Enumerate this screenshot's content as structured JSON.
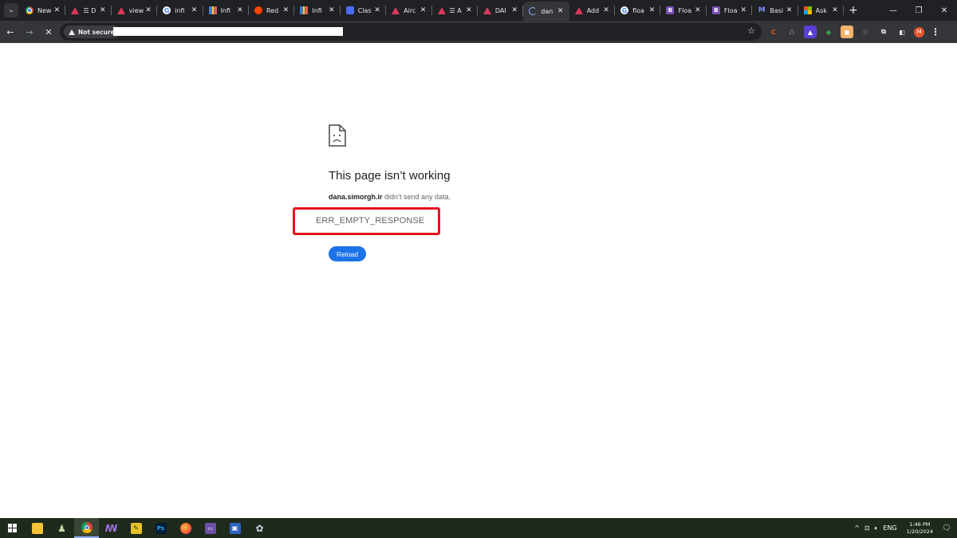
{
  "tabs": [
    {
      "label": "New",
      "favicon": "chrome-icon",
      "active": false
    },
    {
      "label": "☰ D",
      "favicon": "triangle-logo-icon",
      "active": false
    },
    {
      "label": "view",
      "favicon": "triangle-logo-icon",
      "active": false
    },
    {
      "label": "infi",
      "favicon": "google-icon",
      "active": false
    },
    {
      "label": "Infi",
      "favicon": "bars-logo-icon",
      "active": false
    },
    {
      "label": "Red",
      "favicon": "reddit-icon",
      "active": false
    },
    {
      "label": "Infi",
      "favicon": "bars-logo-icon",
      "active": false
    },
    {
      "label": "Clas",
      "favicon": "grid-logo-icon",
      "active": false
    },
    {
      "label": "Airc",
      "favicon": "triangle-logo-icon",
      "active": false
    },
    {
      "label": "☰ A",
      "favicon": "triangle-logo-icon",
      "active": false
    },
    {
      "label": "DAI",
      "favicon": "triangle-logo-icon",
      "active": false
    },
    {
      "label": "dan",
      "favicon": "loading-spinner-icon",
      "active": true
    },
    {
      "label": "Add",
      "favicon": "triangle-logo-icon",
      "active": false
    },
    {
      "label": "floa",
      "favicon": "google-icon",
      "active": false
    },
    {
      "label": "Floa",
      "favicon": "bootstrap-icon",
      "active": false
    },
    {
      "label": "Floa",
      "favicon": "bootstrap-icon",
      "active": false
    },
    {
      "label": "Basi",
      "favicon": "m-logo-icon",
      "active": false
    },
    {
      "label": "Ask",
      "favicon": "microsoft-icon",
      "active": false
    }
  ],
  "toolbar": {
    "security_label": "Not secure"
  },
  "error": {
    "title": "This page isn’t working",
    "host": "dana.simorgh.ir",
    "message": " didn’t send any data.",
    "code": "ERR_EMPTY_RESPONSE",
    "reload_label": "Reload",
    "highlight_color": "#e3141e",
    "button_color": "#1a73e8"
  },
  "taskbar": {
    "language": "ENG",
    "time": "1:46 PM",
    "date": "1/20/2024"
  },
  "colors": {
    "tab_bar": "#202124",
    "toolbar": "#35363a",
    "taskbar": "#1f2a1c"
  }
}
